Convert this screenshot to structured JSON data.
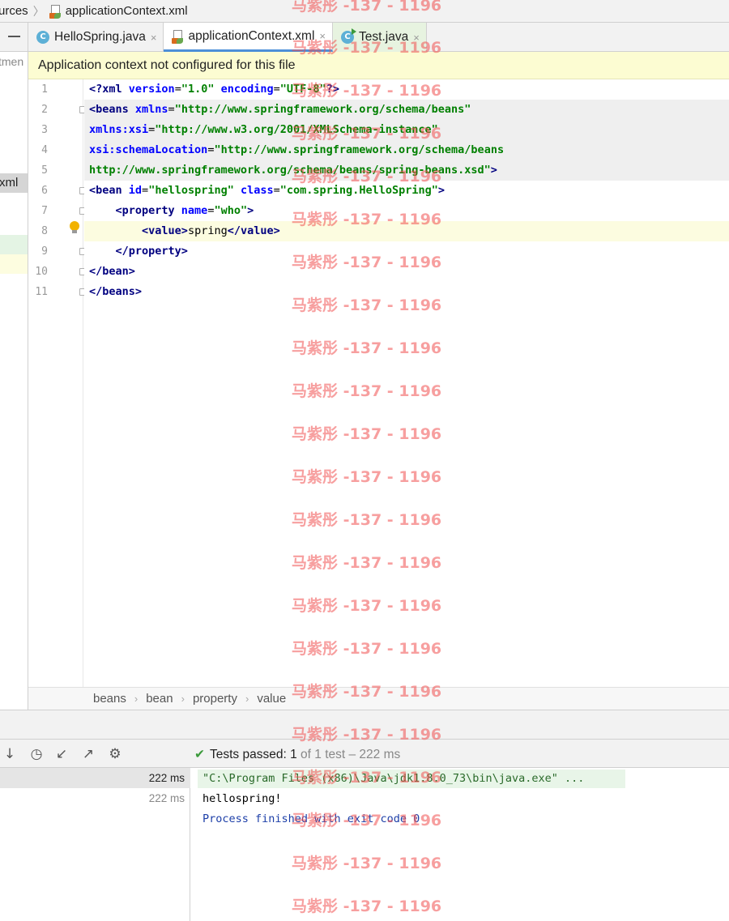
{
  "breadcrumb": {
    "parent": "urces",
    "file": "applicationContext.xml"
  },
  "project": {
    "truncated_top": "tmen",
    "selected_item": "xml"
  },
  "tabs": [
    {
      "label": "HelloSpring.java",
      "close": "×"
    },
    {
      "label": "applicationContext.xml",
      "close": "×"
    },
    {
      "label": "Test.java",
      "close": "×"
    }
  ],
  "banner": {
    "text": "Application context not configured for this file"
  },
  "editor": {
    "line_numbers": [
      "1",
      "2",
      "3",
      "4",
      "5",
      "6",
      "7",
      "8",
      "9",
      "10",
      "11"
    ],
    "lines": [
      {
        "parts": [
          {
            "c": "kw",
            "t": "<?xml "
          },
          {
            "c": "attr",
            "t": "version"
          },
          {
            "c": "pl",
            "t": "="
          },
          {
            "c": "str",
            "t": "\"1.0\""
          },
          {
            "c": "pl",
            "t": " "
          },
          {
            "c": "attr",
            "t": "encoding"
          },
          {
            "c": "pl",
            "t": "="
          },
          {
            "c": "str",
            "t": "\"UTF-8\""
          },
          {
            "c": "kw",
            "t": "?>"
          }
        ]
      },
      {
        "parts": [
          {
            "c": "kw",
            "t": "<beans "
          },
          {
            "c": "attr",
            "t": "xmlns"
          },
          {
            "c": "pl",
            "t": "="
          },
          {
            "c": "str",
            "t": "\"http://www.springframework.org/schema/beans\""
          }
        ]
      },
      {
        "parts": [
          {
            "c": "attr",
            "t": "xmlns:xsi"
          },
          {
            "c": "pl",
            "t": "="
          },
          {
            "c": "str",
            "t": "\"http://www.w3.org/2001/XMLSchema-instance\""
          }
        ]
      },
      {
        "parts": [
          {
            "c": "attr",
            "t": "xsi:schemaLocation"
          },
          {
            "c": "pl",
            "t": "="
          },
          {
            "c": "str",
            "t": "\"http://www.springframework.org/schema/beans"
          }
        ]
      },
      {
        "parts": [
          {
            "c": "url",
            "t": "http://www.springframework.org/schema/beans/spring-beans.xsd\""
          },
          {
            "c": "kw",
            "t": ">"
          }
        ]
      },
      {
        "parts": [
          {
            "c": "kw",
            "t": "<bean "
          },
          {
            "c": "attr",
            "t": "id"
          },
          {
            "c": "pl",
            "t": "="
          },
          {
            "c": "str",
            "t": "\"hellospring\""
          },
          {
            "c": "pl",
            "t": " "
          },
          {
            "c": "attr",
            "t": "class"
          },
          {
            "c": "pl",
            "t": "="
          },
          {
            "c": "str",
            "t": "\"com.spring.HelloSpring\""
          },
          {
            "c": "kw",
            "t": ">"
          }
        ]
      },
      {
        "parts": [
          {
            "c": "pl",
            "t": "    "
          },
          {
            "c": "kw",
            "t": "<property "
          },
          {
            "c": "attr",
            "t": "name"
          },
          {
            "c": "pl",
            "t": "="
          },
          {
            "c": "str",
            "t": "\"who\""
          },
          {
            "c": "kw",
            "t": ">"
          }
        ]
      },
      {
        "parts": [
          {
            "c": "pl",
            "t": "        "
          },
          {
            "c": "kw",
            "t": "<value>"
          },
          {
            "c": "pl",
            "t": "spring"
          },
          {
            "c": "kw",
            "t": "</value>"
          }
        ]
      },
      {
        "parts": [
          {
            "c": "pl",
            "t": "    "
          },
          {
            "c": "kw",
            "t": "</property>"
          }
        ]
      },
      {
        "parts": [
          {
            "c": "kw",
            "t": "</bean>"
          }
        ]
      },
      {
        "parts": [
          {
            "c": "kw",
            "t": "</beans>"
          }
        ]
      }
    ]
  },
  "crumbs": [
    "beans",
    "bean",
    "property",
    "value"
  ],
  "run": {
    "status_label": "Tests passed:",
    "passed": "1",
    "status_detail": "of 1 test – 222 ms",
    "tree_times": [
      "222 ms",
      "222 ms"
    ],
    "console": [
      "\"C:\\Program Files (x86)\\Java\\jdk1.8.0_73\\bin\\java.exe\" ...",
      "hellospring!",
      "Process finished with exit code 0"
    ]
  },
  "watermark": "马紫彤 -137 - 1196",
  "colors": {
    "accent": "#4d8fd8",
    "banner": "#fcfcd2",
    "pass": "#3c9a3c",
    "watermark": "#f05050"
  }
}
